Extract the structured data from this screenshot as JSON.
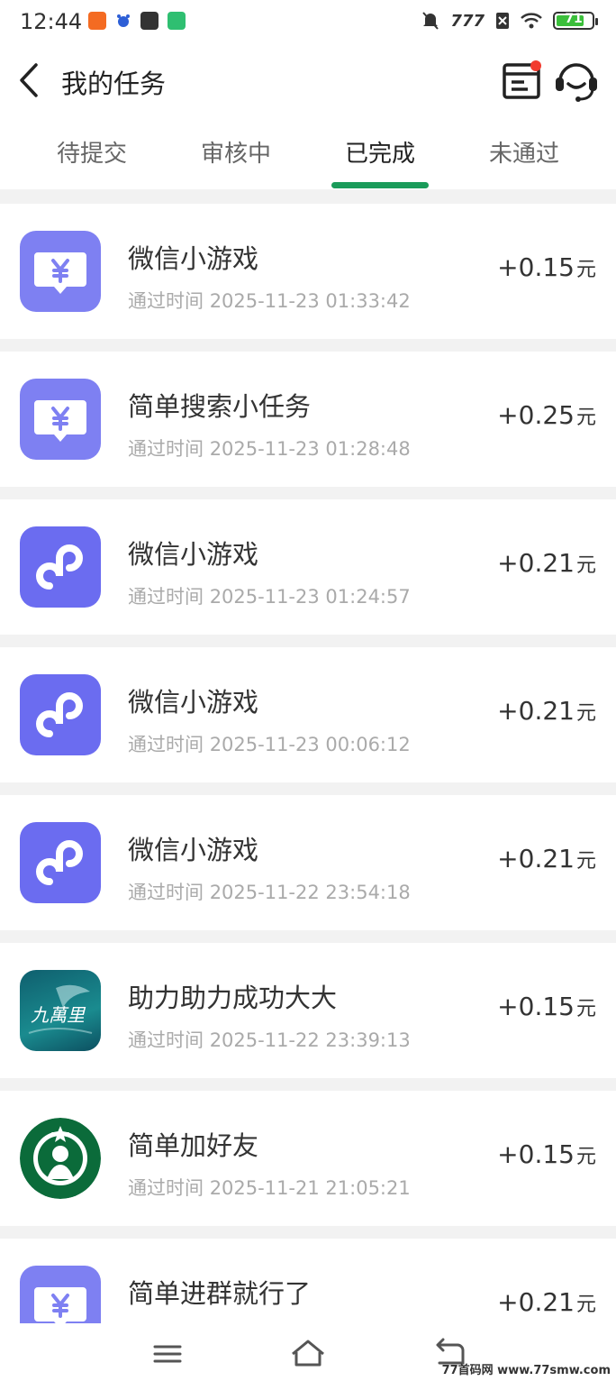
{
  "status_bar": {
    "time": "12:44",
    "network_label": "777",
    "battery": "71"
  },
  "header": {
    "title": "我的任务"
  },
  "tabs": [
    {
      "label": "待提交"
    },
    {
      "label": "审核中"
    },
    {
      "label": "已完成",
      "active": true
    },
    {
      "label": "未通过"
    }
  ],
  "tasks": [
    {
      "icon": "yuan-chat-icon",
      "title": "微信小游戏",
      "time_label": "通过时间",
      "time": "2025-11-23 01:33:42",
      "amount": "+0.15",
      "unit": "元"
    },
    {
      "icon": "yuan-chat-icon",
      "title": "简单搜索小任务",
      "time_label": "通过时间",
      "time": "2025-11-23 01:28:48",
      "amount": "+0.25",
      "unit": "元"
    },
    {
      "icon": "mini-program-icon",
      "title": "微信小游戏",
      "time_label": "通过时间",
      "time": "2025-11-23 01:24:57",
      "amount": "+0.21",
      "unit": "元"
    },
    {
      "icon": "mini-program-icon",
      "title": "微信小游戏",
      "time_label": "通过时间",
      "time": "2025-11-23 00:06:12",
      "amount": "+0.21",
      "unit": "元"
    },
    {
      "icon": "mini-program-icon",
      "title": "微信小游戏",
      "time_label": "通过时间",
      "time": "2025-11-22 23:54:18",
      "amount": "+0.21",
      "unit": "元"
    },
    {
      "icon": "jiuwanli-logo",
      "logo_text": "九萬里",
      "title": "助力助力成功大大",
      "time_label": "通过时间",
      "time": "2025-11-22 23:39:13",
      "amount": "+0.15",
      "unit": "元"
    },
    {
      "icon": "starbucks-logo",
      "title": "简单加好友",
      "time_label": "通过时间",
      "time": "2025-11-21 21:05:21",
      "amount": "+0.15",
      "unit": "元"
    },
    {
      "icon": "yuan-chat-icon",
      "title": "简单进群就行了",
      "time_label": "",
      "time": "",
      "amount": "+0.21",
      "unit": "元"
    }
  ],
  "watermark": "77首码网 www.77smw.com",
  "colors": {
    "accent_green": "#1a9b5a",
    "icon_purple": "#7b7bf2",
    "badge_red": "#f23b2f"
  }
}
